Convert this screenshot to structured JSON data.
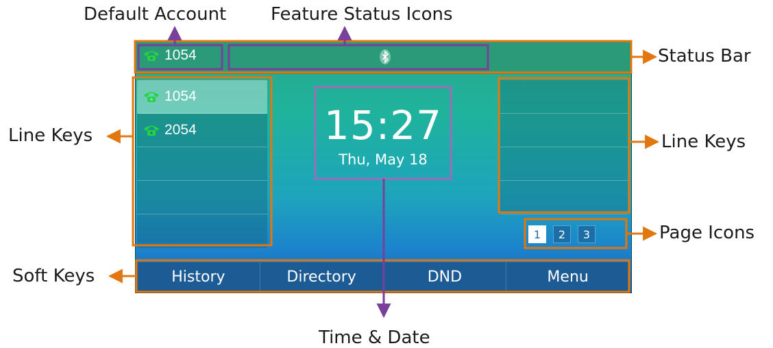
{
  "callouts": {
    "default_account": "Default Account",
    "feature_status_icons": "Feature Status Icons",
    "status_bar": "Status Bar",
    "line_keys_left": "Line Keys",
    "line_keys_right": "Line Keys",
    "page_icons": "Page Icons",
    "soft_keys": "Soft Keys",
    "time_date": "Time & Date"
  },
  "status_bar": {
    "default_account": "1054",
    "feature_icon": "bluetooth-icon"
  },
  "line_keys": [
    {
      "label": "1054",
      "icon": "phone-icon",
      "active": true
    },
    {
      "label": "2054",
      "icon": "phone-icon",
      "active": false
    },
    {
      "label": ""
    },
    {
      "label": ""
    },
    {
      "label": ""
    }
  ],
  "clock": {
    "time": "15:27",
    "date": "Thu, May 18"
  },
  "pages": [
    "1",
    "2",
    "3"
  ],
  "active_page": "1",
  "soft_keys": [
    "History",
    "Directory",
    "DND",
    "Menu"
  ],
  "colors": {
    "callout_orange": "#e2770f",
    "callout_purple": "#7a3f9a",
    "phone_green": "#22d63f"
  }
}
